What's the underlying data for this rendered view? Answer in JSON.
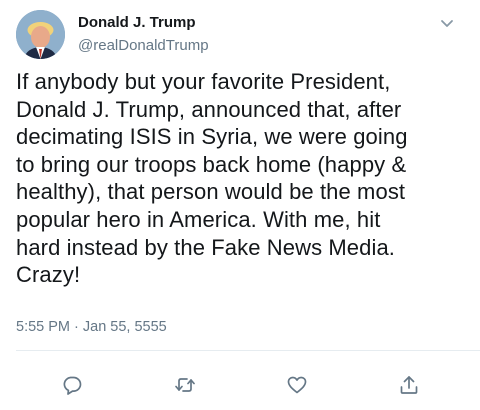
{
  "user": {
    "display_name": "Donald J. Trump",
    "handle": "@realDonaldTrump",
    "avatar": "profile-photo"
  },
  "tweet": {
    "text": "If anybody but your favorite President,\nDonald J. Trump, announced that, after\ndecimating ISIS in Syria, we were going\nto bring our troops back home (happy &\nhealthy), that person would be the most\npopular hero in America. With me, hit\nhard instead by the Fake News Media.\nCrazy!",
    "timestamp": "5:55 PM · Jan 55, 5555"
  },
  "icons": {
    "menu": "chevron-down-icon",
    "reply": "comment-icon",
    "retweet": "retweet-icon",
    "like": "heart-icon",
    "share": "share-icon"
  },
  "colors": {
    "text": "#14171a",
    "secondary": "#657786",
    "divider": "#e6ecf0"
  }
}
